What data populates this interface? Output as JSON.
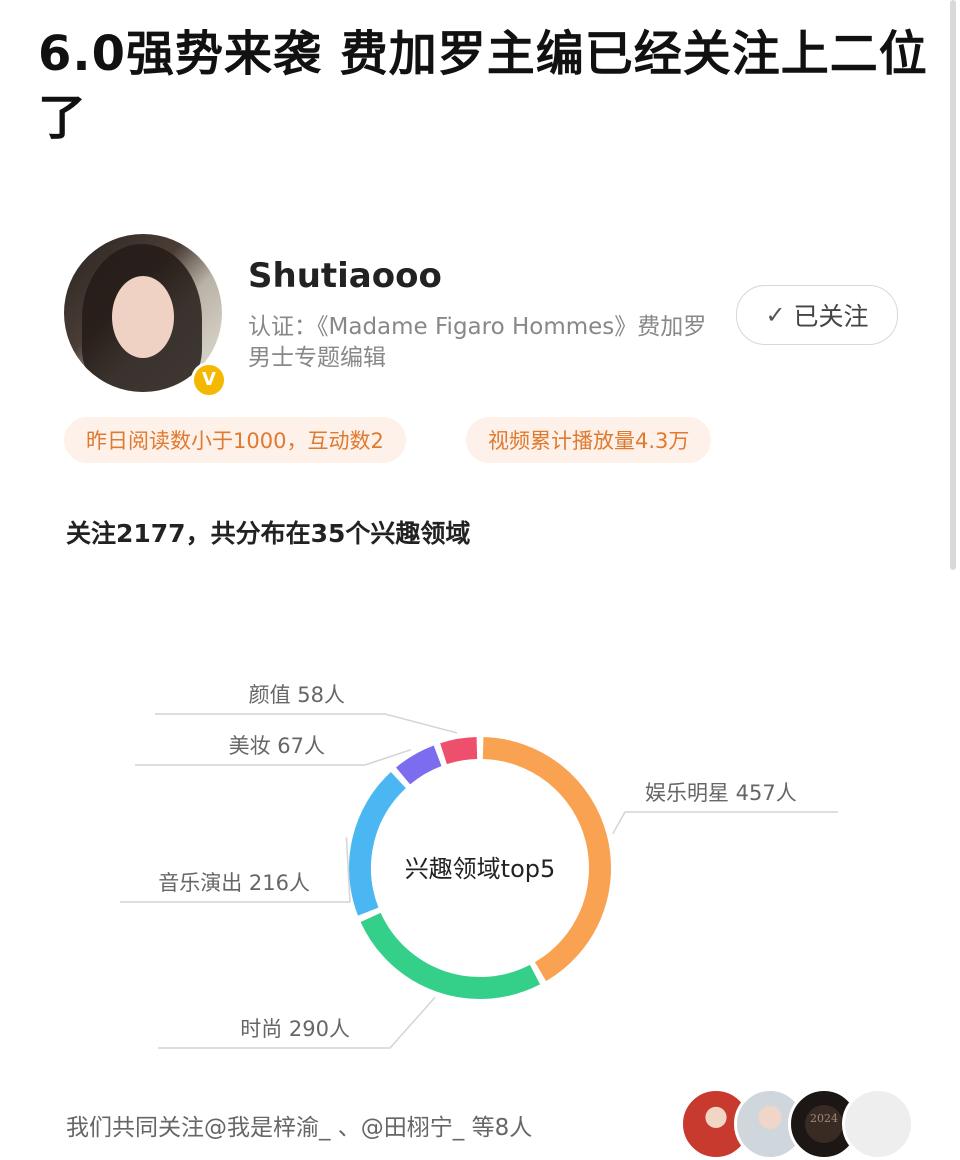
{
  "headline": "6.0强势来袭 费加罗主编已经关注上二位了",
  "profile": {
    "username": "Shutiaooo",
    "certification": "认证：《Madame Figaro Hommes》费加罗男士专题编辑",
    "verified_badge": "V",
    "follow_button": {
      "icon": "✓",
      "label": "已关注"
    }
  },
  "stats": {
    "reads": "昨日阅读数小于1000，互动数2",
    "views": "视频累计播放量4.3万"
  },
  "follow_summary": "关注2177，共分布在35个兴趣领域",
  "chart_data": {
    "type": "pie",
    "variant": "donut",
    "center_label": "兴趣领域top5",
    "categories": [
      "娱乐明星",
      "时尚",
      "音乐演出",
      "美妆",
      "颜值"
    ],
    "values": [
      457,
      290,
      216,
      67,
      58
    ],
    "labels": [
      "娱乐明星 457人",
      "时尚 290人",
      "音乐演出 216人",
      "美妆 67人",
      "颜值 58人"
    ],
    "colors": [
      "#f8a252",
      "#34d08a",
      "#4bb7f2",
      "#7b6cf0",
      "#ee4f6c"
    ],
    "legend_placement": "none"
  },
  "mutual": {
    "text": "我们共同关注@我是梓渝_ 、@田栩宁_ 等8人",
    "avatar3_caption": "2024"
  }
}
